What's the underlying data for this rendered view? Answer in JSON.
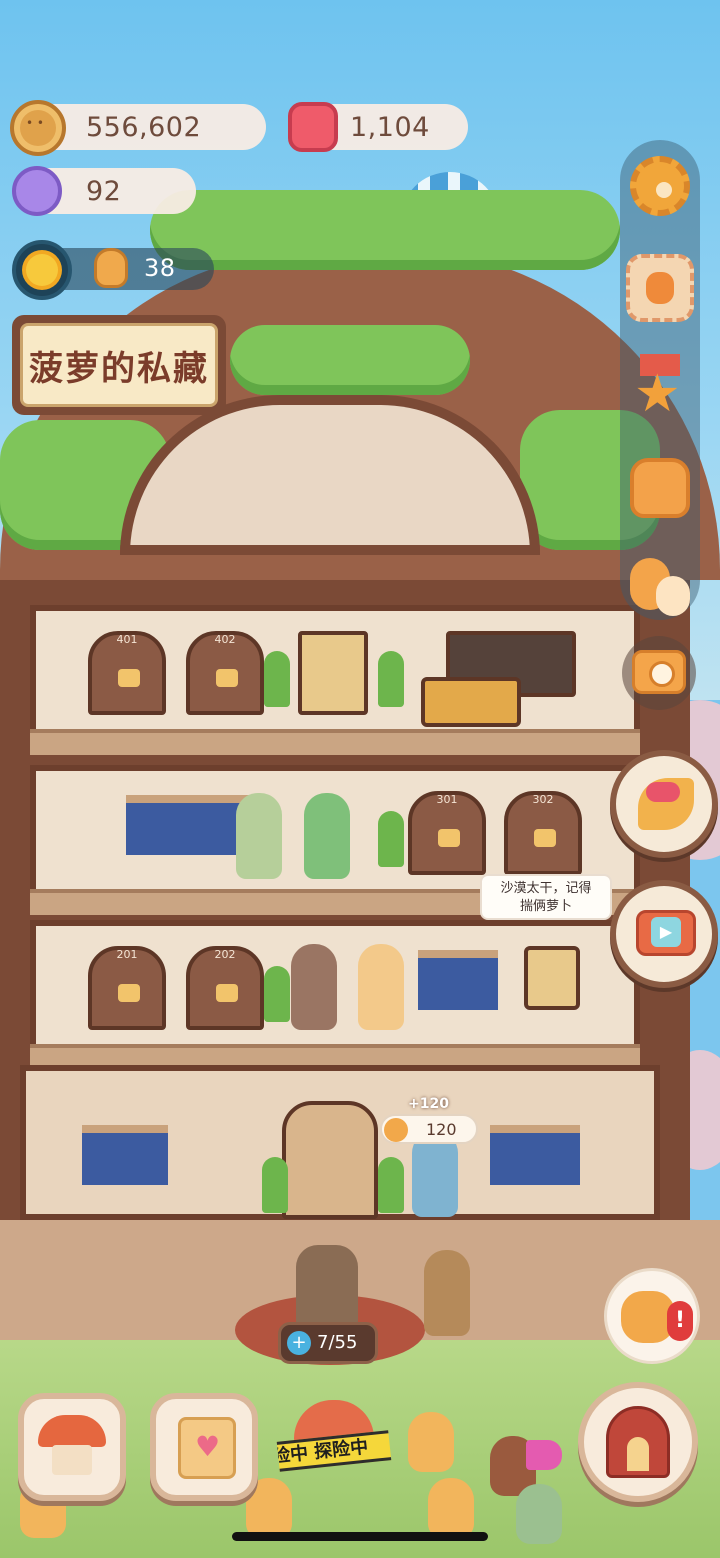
{
  "currencies": {
    "cookies": "556,602",
    "jam": "1,104",
    "candy": "92",
    "workers": "38"
  },
  "building": {
    "title": "菠萝的私藏",
    "room_numbers": [
      "401",
      "402",
      "301",
      "302",
      "201",
      "202"
    ]
  },
  "side_menu": [
    "settings-icon",
    "stamp-icon",
    "medal-icon",
    "backpack-icon",
    "friends-icon",
    "camera-icon"
  ],
  "speech_bubble": {
    "line1": "沙漠太干，记得",
    "line2": "揣俩萝卜"
  },
  "income": {
    "popup": "+120",
    "amount": "120"
  },
  "reception": {
    "capacity": "7/55"
  },
  "bottom_dock": {
    "explore_tape": "险中 探险中"
  },
  "colors": {
    "wood_dark": "#7b4a36",
    "wall_cream": "#efe1cf",
    "sky": "#6ec3ef",
    "accent_orange": "#f2a84a"
  }
}
